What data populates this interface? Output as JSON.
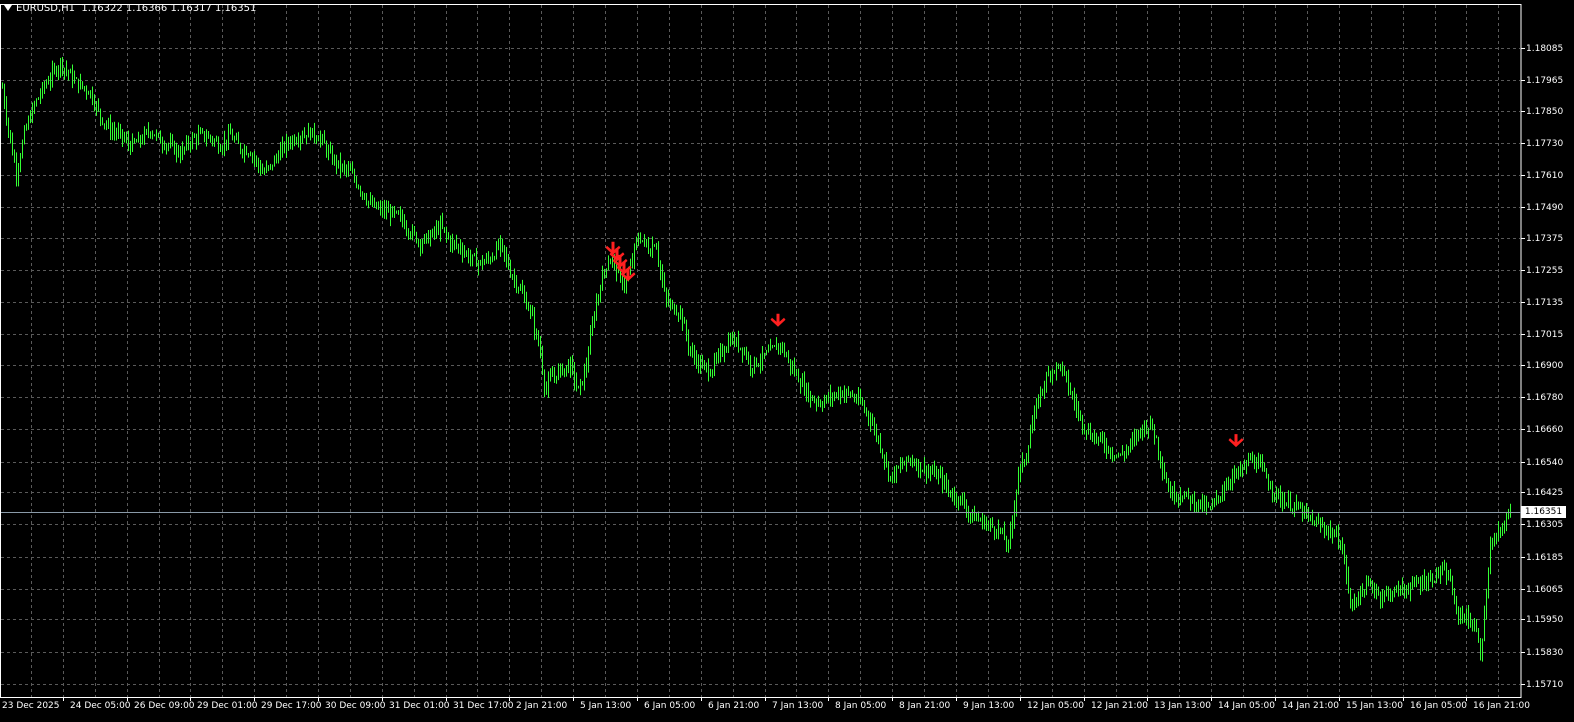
{
  "header": {
    "symbol": "EURUSD,H1",
    "ohlc": "1.16322 1.16366 1.16317 1.16351"
  },
  "colors": {
    "background": "#000000",
    "frame": "#ffffff",
    "grid": "#5a5a5a",
    "candle": "#33ff33",
    "signal_arrow": "#ff2020",
    "current_price_line": "#8a9aa8"
  },
  "chart_data": {
    "type": "candlestick",
    "timeframe": "H1",
    "y_ticks": [
      "1.18085",
      "1.17965",
      "1.17850",
      "1.17730",
      "1.17610",
      "1.17490",
      "1.17375",
      "1.17255",
      "1.17135",
      "1.17015",
      "1.16900",
      "1.16780",
      "1.16660",
      "1.16540",
      "1.16425",
      "1.16305",
      "1.16185",
      "1.16065",
      "1.15950",
      "1.15830",
      "1.15710"
    ],
    "ylim": [
      1.1566,
      1.1825
    ],
    "x_ticks": [
      "23 Dec 2025",
      "24 Dec 05:00",
      "26 Dec 09:00",
      "29 Dec 01:00",
      "29 Dec 17:00",
      "30 Dec 09:00",
      "31 Dec 01:00",
      "31 Dec 17:00",
      "2 Jan 21:00",
      "5 Jan 13:00",
      "6 Jan 05:00",
      "6 Jan 21:00",
      "7 Jan 13:00",
      "8 Jan 05:00",
      "8 Jan 21:00",
      "9 Jan 13:00",
      "12 Jan 05:00",
      "12 Jan 21:00",
      "13 Jan 13:00",
      "14 Jan 05:00",
      "14 Jan 21:00",
      "15 Jan 13:00",
      "16 Jan 05:00",
      "16 Jan 21:00"
    ],
    "current_price": "1.16351",
    "close_path": [
      [
        0,
        1.1799
      ],
      [
        8,
        1.1778
      ],
      [
        16,
        1.1762
      ],
      [
        25,
        1.1778
      ],
      [
        35,
        1.1788
      ],
      [
        45,
        1.1795
      ],
      [
        60,
        1.1803
      ],
      [
        75,
        1.1796
      ],
      [
        90,
        1.1792
      ],
      [
        100,
        1.1783
      ],
      [
        110,
        1.1778
      ],
      [
        120,
        1.1776
      ],
      [
        130,
        1.1772
      ],
      [
        140,
        1.1774
      ],
      [
        150,
        1.1778
      ],
      [
        160,
        1.1774
      ],
      [
        170,
        1.1772
      ],
      [
        180,
        1.1769
      ],
      [
        190,
        1.1774
      ],
      [
        200,
        1.1776
      ],
      [
        210,
        1.1775
      ],
      [
        220,
        1.1772
      ],
      [
        230,
        1.1776
      ],
      [
        240,
        1.1771
      ],
      [
        250,
        1.177
      ],
      [
        262,
        1.1762
      ],
      [
        270,
        1.1764
      ],
      [
        280,
        1.177
      ],
      [
        290,
        1.1774
      ],
      [
        300,
        1.1776
      ],
      [
        310,
        1.1777
      ],
      [
        320,
        1.1775
      ],
      [
        330,
        1.1768
      ],
      [
        340,
        1.1764
      ],
      [
        350,
        1.1762
      ],
      [
        360,
        1.1756
      ],
      [
        370,
        1.175
      ],
      [
        380,
        1.1748
      ],
      [
        390,
        1.1747
      ],
      [
        400,
        1.1745
      ],
      [
        410,
        1.174
      ],
      [
        420,
        1.1736
      ],
      [
        430,
        1.1738
      ],
      [
        440,
        1.1742
      ],
      [
        450,
        1.1736
      ],
      [
        460,
        1.1734
      ],
      [
        470,
        1.173
      ],
      [
        480,
        1.1728
      ],
      [
        490,
        1.173
      ],
      [
        500,
        1.1735
      ],
      [
        510,
        1.1725
      ],
      [
        520,
        1.1718
      ],
      [
        530,
        1.171
      ],
      [
        540,
        1.1695
      ],
      [
        545,
        1.168
      ],
      [
        550,
        1.1685
      ],
      [
        560,
        1.1688
      ],
      [
        570,
        1.169
      ],
      [
        578,
        1.168
      ],
      [
        585,
        1.1688
      ],
      [
        590,
        1.17
      ],
      [
        595,
        1.1712
      ],
      [
        600,
        1.172
      ],
      [
        605,
        1.1727
      ],
      [
        610,
        1.173
      ],
      [
        615,
        1.1727
      ],
      [
        620,
        1.1722
      ],
      [
        625,
        1.172
      ],
      [
        630,
        1.1726
      ],
      [
        635,
        1.1735
      ],
      [
        640,
        1.1738
      ],
      [
        645,
        1.1735
      ],
      [
        650,
        1.1733
      ],
      [
        655,
        1.1737
      ],
      [
        660,
        1.1725
      ],
      [
        665,
        1.1715
      ],
      [
        670,
        1.1712
      ],
      [
        680,
        1.171
      ],
      [
        690,
        1.1695
      ],
      [
        700,
        1.169
      ],
      [
        710,
        1.1688
      ],
      [
        720,
        1.1694
      ],
      [
        730,
        1.17
      ],
      [
        740,
        1.1697
      ],
      [
        745,
        1.1695
      ],
      [
        750,
        1.169
      ],
      [
        760,
        1.1692
      ],
      [
        770,
        1.1695
      ],
      [
        780,
        1.1698
      ],
      [
        790,
        1.169
      ],
      [
        800,
        1.1684
      ],
      [
        810,
        1.1678
      ],
      [
        820,
        1.1676
      ],
      [
        830,
        1.1678
      ],
      [
        840,
        1.168
      ],
      [
        850,
        1.1679
      ],
      [
        860,
        1.1676
      ],
      [
        870,
        1.167
      ],
      [
        880,
        1.166
      ],
      [
        890,
        1.1648
      ],
      [
        900,
        1.1652
      ],
      [
        910,
        1.1655
      ],
      [
        920,
        1.1652
      ],
      [
        930,
        1.165
      ],
      [
        940,
        1.1648
      ],
      [
        950,
        1.1642
      ],
      [
        960,
        1.164
      ],
      [
        970,
        1.1634
      ],
      [
        980,
        1.1632
      ],
      [
        990,
        1.163
      ],
      [
        1000,
        1.1628
      ],
      [
        1008,
        1.1622
      ],
      [
        1012,
        1.1632
      ],
      [
        1018,
        1.165
      ],
      [
        1025,
        1.1655
      ],
      [
        1030,
        1.1665
      ],
      [
        1040,
        1.168
      ],
      [
        1050,
        1.1688
      ],
      [
        1060,
        1.169
      ],
      [
        1070,
        1.168
      ],
      [
        1080,
        1.167
      ],
      [
        1090,
        1.1664
      ],
      [
        1100,
        1.1662
      ],
      [
        1110,
        1.1658
      ],
      [
        1120,
        1.1656
      ],
      [
        1130,
        1.166
      ],
      [
        1140,
        1.1666
      ],
      [
        1150,
        1.1668
      ],
      [
        1155,
        1.1664
      ],
      [
        1160,
        1.1655
      ],
      [
        1165,
        1.1648
      ],
      [
        1170,
        1.1642
      ],
      [
        1180,
        1.1642
      ],
      [
        1190,
        1.164
      ],
      [
        1200,
        1.1638
      ],
      [
        1210,
        1.1636
      ],
      [
        1220,
        1.1642
      ],
      [
        1230,
        1.1648
      ],
      [
        1240,
        1.165
      ],
      [
        1250,
        1.1655
      ],
      [
        1260,
        1.1652
      ],
      [
        1270,
        1.1645
      ],
      [
        1280,
        1.164
      ],
      [
        1290,
        1.1638
      ],
      [
        1300,
        1.1636
      ],
      [
        1310,
        1.1632
      ],
      [
        1320,
        1.163
      ],
      [
        1330,
        1.1628
      ],
      [
        1340,
        1.1624
      ],
      [
        1345,
        1.1615
      ],
      [
        1350,
        1.16
      ],
      [
        1360,
        1.1605
      ],
      [
        1370,
        1.1608
      ],
      [
        1380,
        1.1604
      ],
      [
        1390,
        1.1605
      ],
      [
        1400,
        1.1606
      ],
      [
        1410,
        1.1607
      ],
      [
        1420,
        1.1609
      ],
      [
        1430,
        1.161
      ],
      [
        1440,
        1.1613
      ],
      [
        1450,
        1.161
      ],
      [
        1455,
        1.1598
      ],
      [
        1465,
        1.1596
      ],
      [
        1475,
        1.1592
      ],
      [
        1480,
        1.1582
      ],
      [
        1485,
        1.16
      ],
      [
        1490,
        1.1622
      ],
      [
        1495,
        1.1625
      ],
      [
        1500,
        1.1628
      ],
      [
        1505,
        1.1632
      ],
      [
        1510,
        1.1635
      ]
    ],
    "down_arrows": [
      {
        "x": 613,
        "price": 1.17324
      },
      {
        "x": 617,
        "price": 1.173
      },
      {
        "x": 620,
        "price": 1.17275
      },
      {
        "x": 624,
        "price": 1.1725
      },
      {
        "x": 628,
        "price": 1.17225
      },
      {
        "x": 778,
        "price": 1.17055
      },
      {
        "x": 1236,
        "price": 1.16605
      }
    ]
  }
}
